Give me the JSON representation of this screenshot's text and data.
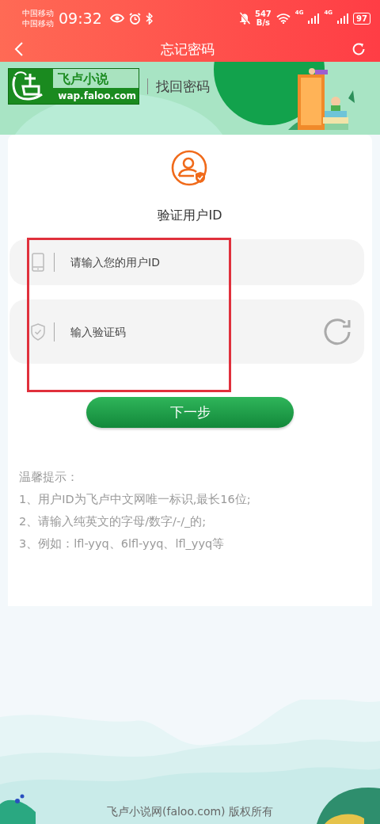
{
  "status_bar": {
    "carriers": [
      "中国移动",
      "中国移动"
    ],
    "time": "09:32",
    "speed_value": "547",
    "speed_unit": "B/s",
    "networks": [
      "4G",
      "4G"
    ],
    "battery": "97"
  },
  "nav": {
    "title": "忘记密码"
  },
  "header": {
    "logo_name": "飞卢小说",
    "logo_url": "wap.faloo.com",
    "page_title": "找回密码"
  },
  "card": {
    "title": "验证用户ID",
    "fields": [
      {
        "kind": "user-id",
        "placeholder": "请输入您的用户ID"
      },
      {
        "kind": "captcha",
        "placeholder": "输入验证码"
      }
    ],
    "button": "下一步",
    "tips_title": "温馨提示：",
    "tips": [
      "1、用户ID为飞卢中文网唯一标识,最长16位;",
      "2、请输入纯英文的字母/数字/-/_的;",
      "3、例如：lfl-yyq、6lfl-yyq、lfl_yyq等"
    ]
  },
  "annotation": {
    "kind": "highlight-frame"
  },
  "footer": "飞卢小说网(faloo.com) 版权所有"
}
